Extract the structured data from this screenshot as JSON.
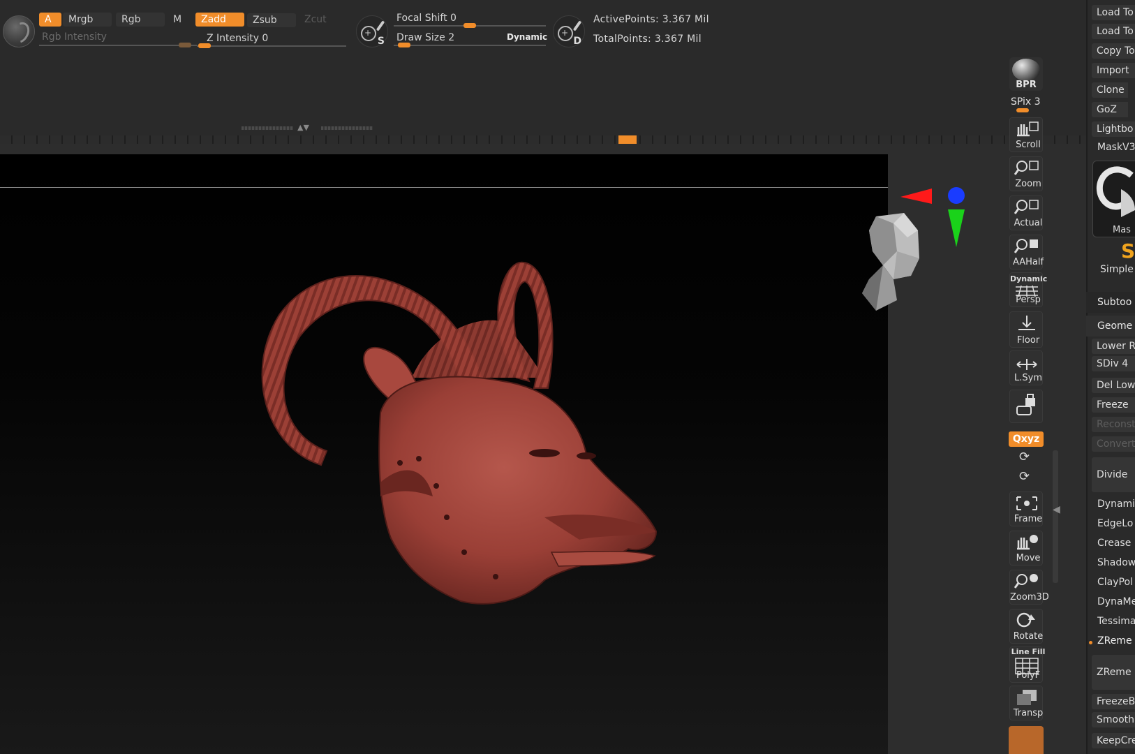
{
  "toolbar": {
    "a_label": "A",
    "mrgb_label": "Mrgb",
    "rgb_label": "Rgb",
    "m_label": "M",
    "zadd_label": "Zadd",
    "zsub_label": "Zsub",
    "zcut_label": "Zcut",
    "rgb_intensity_label": "Rgb Intensity",
    "z_intensity_label": "Z Intensity 0",
    "focal_shift_label": "Focal Shift 0",
    "draw_size_label": "Draw Size 2",
    "dynamic_label": "Dynamic",
    "stroke_s_letter": "S",
    "stroke_d_letter": "D",
    "active_points": "ActivePoints: 3.367 Mil",
    "total_points": "TotalPoints: 3.367 Mil"
  },
  "colors": {
    "accent": "#f18d2a",
    "model": "#a0433a",
    "gizmo_x": "#ff1a1a",
    "gizmo_y": "#1ad21a",
    "gizmo_z": "#1a3cff"
  },
  "right_toolbar": {
    "bpr": "BPR",
    "spix": "SPix 3",
    "scroll": "Scroll",
    "zoom": "Zoom",
    "actual": "Actual",
    "aahalf": "AAHalf",
    "dynamic": "Dynamic",
    "persp": "Persp",
    "floor": "Floor",
    "lsym": "L.Sym",
    "xyz": "Qxyz",
    "frame": "Frame",
    "move": "Move",
    "zoom3d": "Zoom3D",
    "rotate": "Rotate",
    "line_fill": "Line Fill",
    "polyf": "PolyF",
    "transp": "Transp"
  },
  "right_panel": {
    "load_tool_1": "Load To",
    "load_tool_2": "Load To",
    "copy_tool": "Copy To",
    "import": "Import",
    "clone": "Clone",
    "goz": "GoZ",
    "lightbox": "Lightbo",
    "maskv3": "MaskV3",
    "mask_label": "Mas",
    "simple_s": "S",
    "simple": "Simple",
    "subtool": "Subtoo",
    "geometry": "Geome",
    "lower_res": "Lower R",
    "sdiv": "SDiv 4",
    "del_lower": "Del Low",
    "freeze": "Freeze",
    "reconstruct": "Reconst",
    "convert": "Convert",
    "divide": "Divide",
    "dynamic": "Dynami",
    "edgeloop": "EdgeLo",
    "crease": "Crease",
    "shadowbox": "Shadow",
    "claypolish": "ClayPol",
    "dynamesh": "DynaMe",
    "tessimate": "Tessima",
    "zremesher": "ZReme",
    "zremesher_btn": "ZReme",
    "freeze_border": "FreezeB",
    "smooth": "Smooth",
    "keep_creases": "KeepCre"
  }
}
